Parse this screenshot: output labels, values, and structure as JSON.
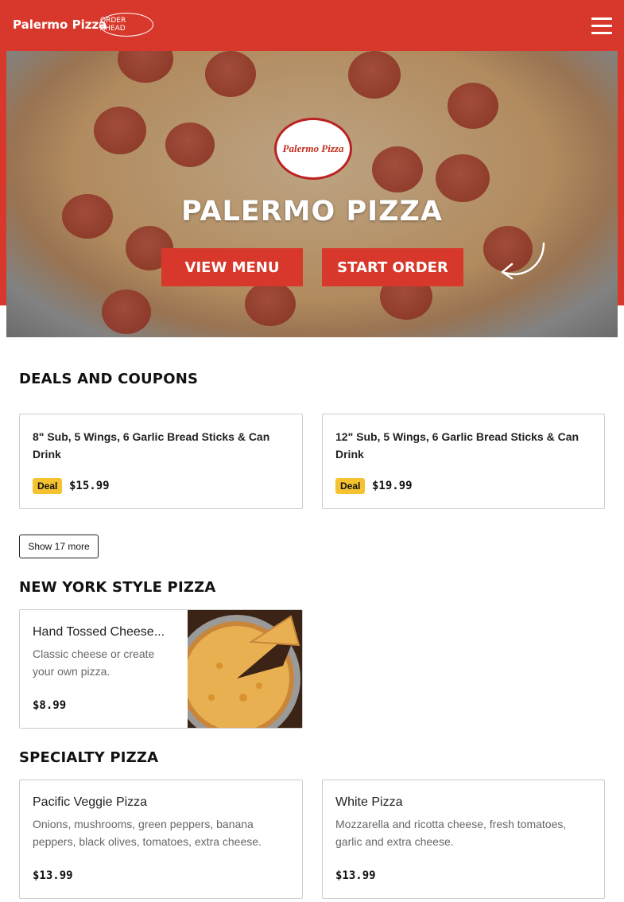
{
  "header": {
    "brand": "Palermo Pizza",
    "order_ahead_badge": "ORDER AHEAD",
    "menu_icon": "hamburger-icon",
    "bg_color": "#d8382b"
  },
  "hero": {
    "logo_text": "Palermo Pizza",
    "title": "PALERMO PIZZA",
    "view_menu_label": "VIEW MENU",
    "start_order_label": "START ORDER",
    "arrow_icon": "curved-arrow-icon"
  },
  "deals": {
    "title": "DEALS AND COUPONS",
    "items": [
      {
        "name": "8\" Sub, 5 Wings, 6 Garlic Bread Sticks & Can Drink",
        "badge": "Deal",
        "price": "$15.99"
      },
      {
        "name": "12\" Sub, 5 Wings, 6 Garlic Bread Sticks & Can Drink",
        "badge": "Deal",
        "price": "$19.99"
      }
    ],
    "show_more_label": "Show 17 more"
  },
  "ny_pizza": {
    "title": "NEW YORK STYLE PIZZA",
    "items": [
      {
        "name": "Hand Tossed Cheese...",
        "description": "Classic cheese or create your own pizza.",
        "price": "$8.99"
      }
    ]
  },
  "specialty": {
    "title": "SPECIALTY PIZZA",
    "items": [
      {
        "name": "Pacific Veggie Pizza",
        "description": "Onions, mushrooms, green peppers, banana peppers, black olives, tomatoes, extra cheese.",
        "price": "$13.99"
      },
      {
        "name": "White Pizza",
        "description": "Mozzarella and ricotta cheese, fresh tomatoes, garlic and extra cheese.",
        "price": "$13.99"
      }
    ]
  }
}
